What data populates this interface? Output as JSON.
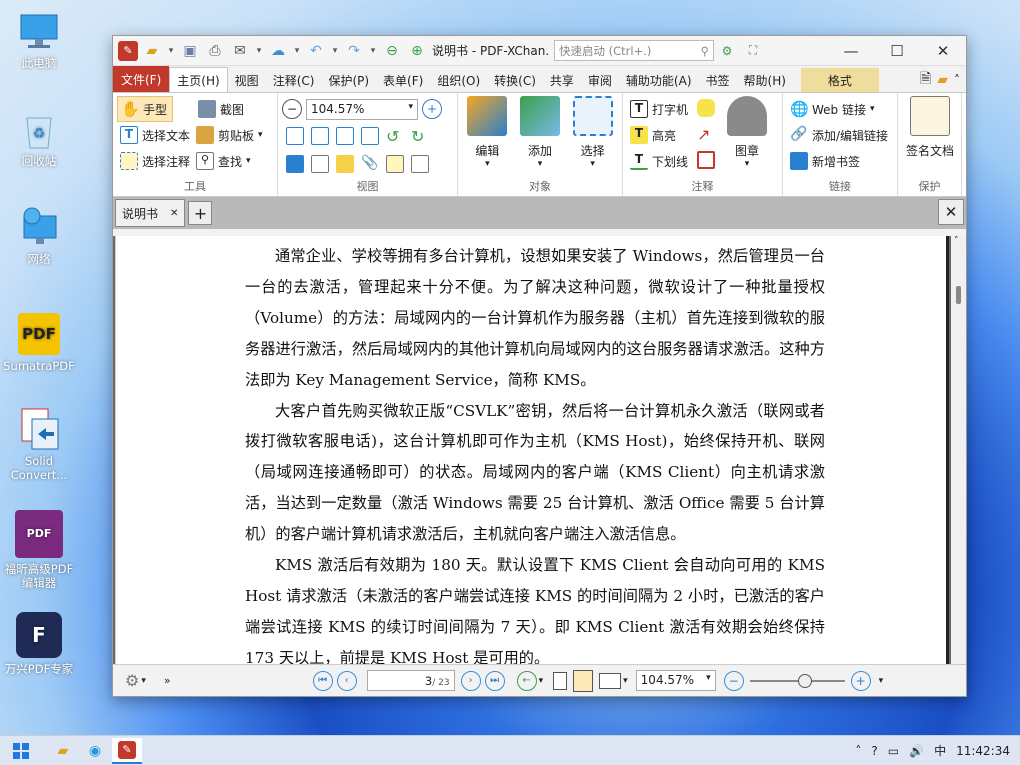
{
  "desktop": {
    "icons": [
      {
        "label": "此电脑",
        "icon": "computer-icon"
      },
      {
        "label": "回收站",
        "icon": "recycle-bin-icon"
      },
      {
        "label": "网络",
        "icon": "network-icon"
      },
      {
        "label": "SumatraPDF",
        "icon": "sumatrapdf-icon"
      },
      {
        "label": "Solid Convert...",
        "icon": "solid-converter-icon"
      },
      {
        "label": "福昕高级PDF编辑器",
        "icon": "foxit-editor-icon"
      },
      {
        "label": "万兴PDF专家",
        "icon": "wondershare-pdf-icon"
      }
    ]
  },
  "window": {
    "title": "说明书 - PDF-XChan...",
    "search_placeholder": "快速启动 (Ctrl+.)"
  },
  "menu_tabs": [
    "文件(F)",
    "主页(H)",
    "视图",
    "注释(C)",
    "保护(P)",
    "表单(F)",
    "组织(O)",
    "转换(C)",
    "共享",
    "审阅",
    "辅助功能(A)",
    "书签",
    "帮助(H)",
    "格式"
  ],
  "ribbon": {
    "tools": {
      "hand": "手型",
      "snapshot": "截图",
      "select_text": "选择文本",
      "clipboard": "剪贴板",
      "select_annot": "选择注释",
      "find": "查找",
      "label": "工具"
    },
    "view": {
      "zoom": "104.57%",
      "label": "视图"
    },
    "objects": {
      "edit": "编辑",
      "add": "添加",
      "select": "选择",
      "label": "对象"
    },
    "annot": {
      "typewriter": "打字机",
      "highlight": "高亮",
      "underline": "下划线",
      "stamp": "图章",
      "label": "注释"
    },
    "links": {
      "web": "Web 链接",
      "add_edit": "添加/编辑链接",
      "bookmark": "新增书签",
      "label": "链接"
    },
    "protect": {
      "sign": "签名文档",
      "label": "保护"
    }
  },
  "doc_tab": {
    "name": "说明书"
  },
  "document": {
    "paragraphs": [
      "通常企业、学校等拥有多台计算机，设想如果安装了 Windows，然后管理员一台一台的去激活，管理起来十分不便。为了解决这种问题，微软设计了一种批量授权（Volume）的方法：局域网内的一台计算机作为服务器（主机）首先连接到微软的服务器进行激活，然后局域网内的其他计算机向局域网内的这台服务器请求激活。这种方法即为 Key Management Service，简称 KMS。",
      "大客户首先购买微软正版“CSVLK”密钥，然后将一台计算机永久激活（联网或者拨打微软客服电话)，这台计算机即可作为主机（KMS Host)，始终保持开机、联网（局域网连接通畅即可）的状态。局域网内的客户端（KMS Client）向主机请求激活，当达到一定数量（激活 Windows 需要 25 台计算机、激活 Office 需要 5 台计算机）的客户端计算机请求激活后，主机就向客户端注入激活信息。",
      "KMS 激活后有效期为 180 天。默认设置下 KMS Client 会自动向可用的 KMS Host 请求激活（未激活的客户端尝试连接 KMS 的时间间隔为 2 小时，已激活的客户端尝试连接 KMS 的续订时间间隔为 7 天）。即 KMS Client 激活有效期会始终保持 173 天以上，前提是 KMS Host 是可用的。"
    ]
  },
  "status": {
    "page": "3",
    "total": "/ 23",
    "zoom": "104.57%",
    "zoom_level": 0.6
  },
  "taskbar": {
    "ime": "中",
    "time": "11:42:34"
  }
}
